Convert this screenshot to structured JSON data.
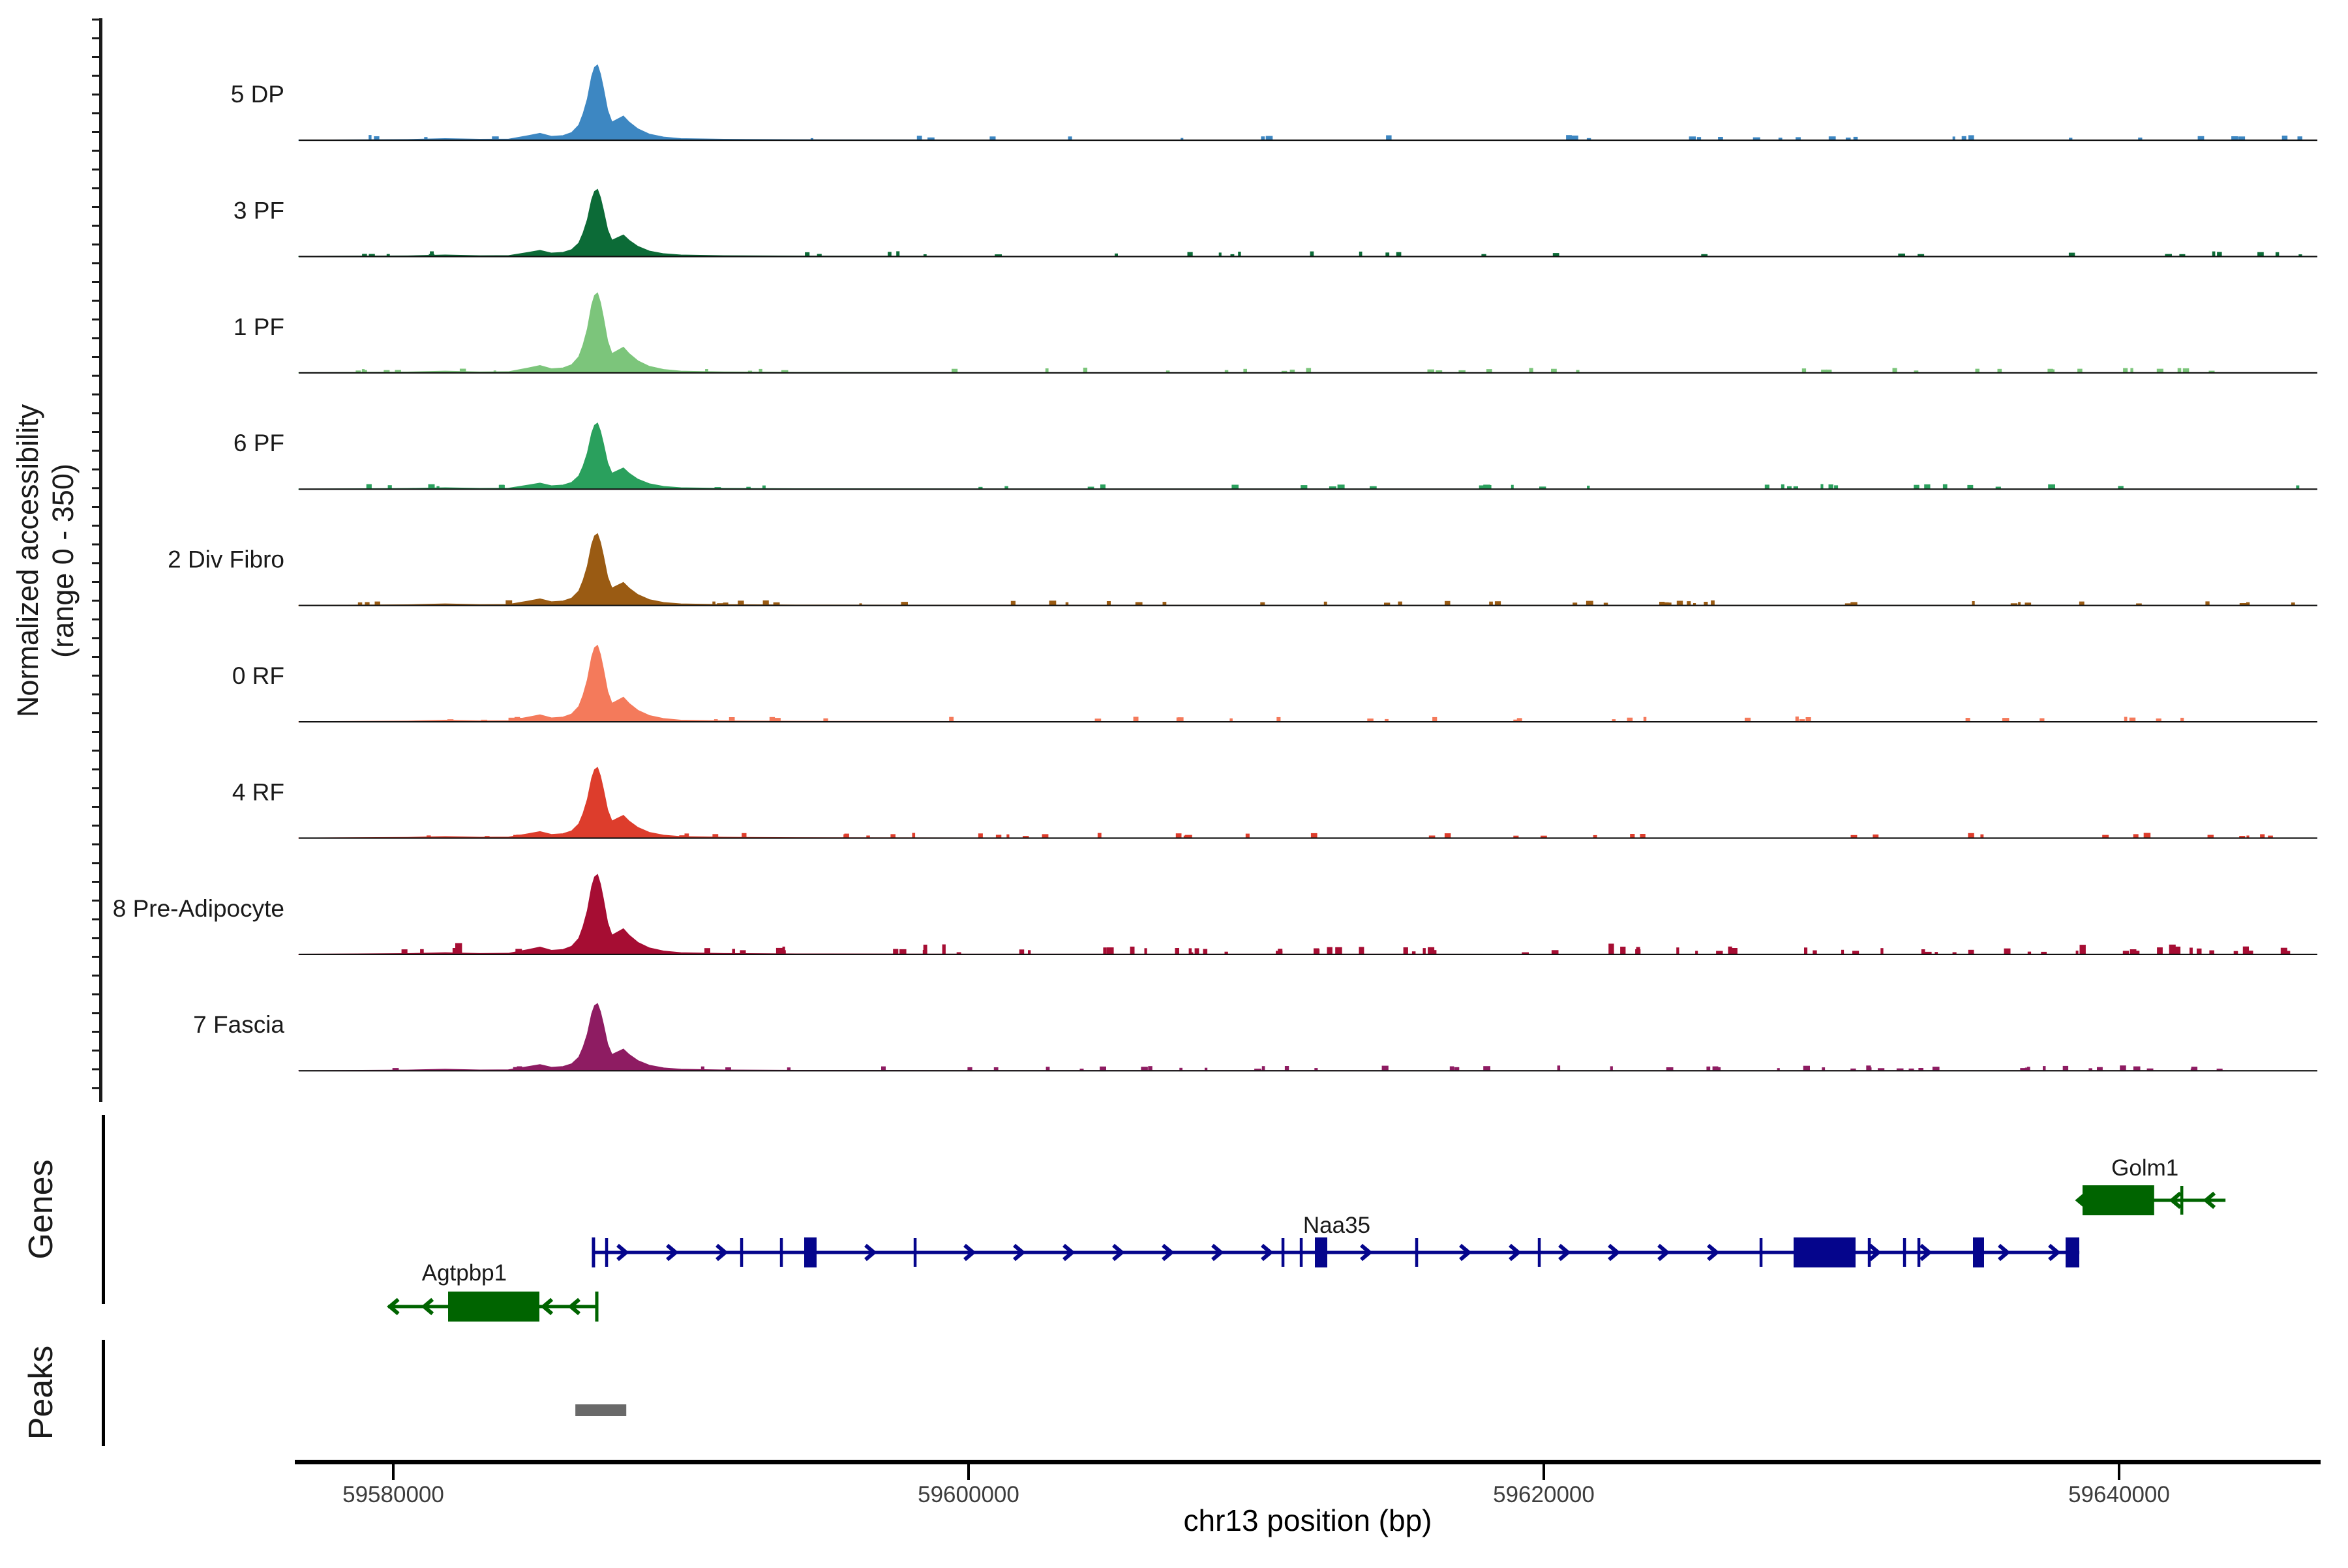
{
  "y_axis": {
    "title_line1": "Normalized accessibility",
    "title_line2": "(range 0 - 350)"
  },
  "x_axis": {
    "title": "chr13 position (bp)",
    "ticks": [
      {
        "label": "59580000",
        "bp": 59580000
      },
      {
        "label": "59600000",
        "bp": 59600000
      },
      {
        "label": "59620000",
        "bp": 59620000
      },
      {
        "label": "59640000",
        "bp": 59640000
      }
    ]
  },
  "sections": {
    "genes_label": "Genes",
    "peaks_label": "Peaks"
  },
  "tracks": [
    {
      "label": "5 DP",
      "color": "#3D87C2",
      "peak_value": 325
    },
    {
      "label": "3 PF",
      "color": "#0C6B37",
      "peak_value": 290
    },
    {
      "label": "1 PF",
      "color": "#7CC57B",
      "peak_value": 345
    },
    {
      "label": "6 PF",
      "color": "#2AA05D",
      "peak_value": 285
    },
    {
      "label": "2 Div Fibro",
      "color": "#9A5B13",
      "peak_value": 310
    },
    {
      "label": "0 RF",
      "color": "#F47A5B",
      "peak_value": 330
    },
    {
      "label": "4 RF",
      "color": "#DD3D2C",
      "peak_value": 305
    },
    {
      "label": "8 Pre-Adipocyte",
      "color": "#A60D33",
      "peak_value": 345
    },
    {
      "label": "7 Fascia",
      "color": "#8E1C62",
      "peak_value": 290
    }
  ],
  "genes": [
    {
      "name": "Golm1",
      "strand": "-",
      "color": "#006400",
      "row": 0,
      "line_bp": [
        59638575,
        59643700
      ],
      "exons": [
        {
          "start_bp": 59638730,
          "end_bp": 59641220
        }
      ],
      "exon_ticks_bp": [
        59642180
      ],
      "chevrons_bp": [
        59638575,
        59641840,
        59643020
      ],
      "label_bp": 59640900,
      "label_dy": -38
    },
    {
      "name": "Naa35",
      "strand": "+",
      "color": "#05058C",
      "row": 1,
      "line_bp": [
        59586960,
        59638620
      ],
      "start_bar_bp": 59586960,
      "exons": [
        {
          "start_bp": 59594286,
          "end_bp": 59594717
        },
        {
          "start_bp": 59612041,
          "end_bp": 59612472
        },
        {
          "start_bp": 59628684,
          "end_bp": 59630838
        },
        {
          "start_bp": 59634921,
          "end_bp": 59635306
        },
        {
          "start_bp": 59638141,
          "end_bp": 59638617
        }
      ],
      "exon_ticks_bp": [
        59587415,
        59592109,
        59593492,
        59598141,
        59610930,
        59611565,
        59615578,
        59619841,
        59627551,
        59631315,
        59632540,
        59633039
      ],
      "chevrons_bp": [
        59631632,
        59633401,
        59636122,
        59637869
      ],
      "chevrons_auto": true,
      "label_bp": 59612800,
      "label_dy": -30
    },
    {
      "name": "Agtpbp1",
      "strand": "-",
      "color": "#006400",
      "row": 2,
      "line_bp": [
        59579820,
        59587075
      ],
      "end_bar_bp": 59587075,
      "exons": [
        {
          "start_bp": 59581905,
          "end_bp": 59585080
        }
      ],
      "exon_ticks_bp": [],
      "chevrons_bp": [
        59579880,
        59581070,
        59585220,
        59586170
      ],
      "label_bp": 59582470,
      "label_dy": -40
    }
  ],
  "peaks": [
    {
      "start_bp": 59586330,
      "end_bp": 59588100,
      "color": "#696969"
    }
  ],
  "chart_data": {
    "type": "area",
    "title": "",
    "xlabel": "chr13 position (bp)",
    "ylabel": "Normalized accessibility (range 0 - 350)",
    "chromosome": "chr13",
    "x_range_bp": [
      59576700,
      59646700
    ],
    "x_ticks_bp": [
      59580000,
      59600000,
      59620000,
      59640000
    ],
    "per_track_range": [
      0,
      350
    ],
    "peak_summit_bp": 59587100,
    "profile_bp": [
      59576700,
      59580500,
      59581800,
      59583000,
      59584000,
      59584700,
      59585100,
      59585500,
      59585900,
      59586200,
      59586450,
      59586600,
      59586750,
      59586900,
      59587000,
      59587100,
      59587200,
      59587300,
      59587450,
      59587600,
      59587800,
      59588000,
      59588200,
      59588500,
      59588900,
      59589400,
      59590000,
      59591500,
      59594000,
      59600000,
      59620000,
      59646700
    ],
    "profile_frac": [
      0,
      0.008,
      0.02,
      0.01,
      0.012,
      0.06,
      0.09,
      0.05,
      0.06,
      0.1,
      0.2,
      0.35,
      0.55,
      0.85,
      0.97,
      1.0,
      0.88,
      0.7,
      0.4,
      0.24,
      0.28,
      0.32,
      0.24,
      0.15,
      0.08,
      0.04,
      0.02,
      0.01,
      0.005,
      0.002,
      0.001,
      0
    ],
    "series": [
      {
        "name": "5 DP",
        "color": "#3D87C2",
        "peak_value": 325
      },
      {
        "name": "3 PF",
        "color": "#0C6B37",
        "peak_value": 290
      },
      {
        "name": "1 PF",
        "color": "#7CC57B",
        "peak_value": 345
      },
      {
        "name": "6 PF",
        "color": "#2AA05D",
        "peak_value": 285
      },
      {
        "name": "2 Div Fibro",
        "color": "#9A5B13",
        "peak_value": 310
      },
      {
        "name": "0 RF",
        "color": "#F47A5B",
        "peak_value": 330
      },
      {
        "name": "4 RF",
        "color": "#DD3D2C",
        "peak_value": 305
      },
      {
        "name": "8 Pre-Adipocyte",
        "color": "#A60D33",
        "peak_value": 345
      },
      {
        "name": "7 Fascia",
        "color": "#8E1C62",
        "peak_value": 290
      }
    ]
  }
}
